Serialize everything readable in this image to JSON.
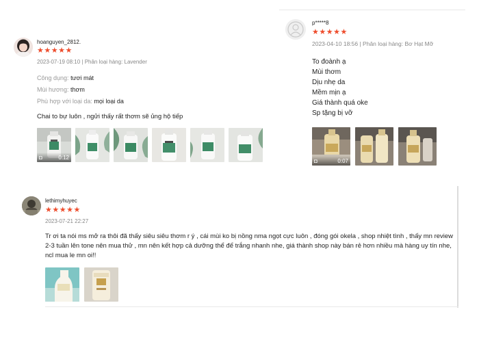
{
  "colors": {
    "star": "#ee4d2d",
    "meta": "#888888",
    "label": "#999999"
  },
  "reviews": [
    {
      "username": "hoanguyen_2812.",
      "rating": 5,
      "stars": "★★★★★",
      "meta": "2023-07-19 08:10 | Phân loại hàng: Lavender",
      "attributes": [
        {
          "label": "Công dụng:",
          "value": "tươi mát"
        },
        {
          "label": "Mùi hương:",
          "value": "thơm"
        },
        {
          "label": "Phù hợp với loại da:",
          "value": "mọi loại da"
        }
      ],
      "comment": "Chai to bự luôn , ngửi thấy rất thơm sẽ ủng hộ tiếp",
      "video_duration": "0:12"
    },
    {
      "username": "p*****8",
      "rating": 5,
      "stars": "★★★★★",
      "meta": "2023-04-10 18:56 | Phân loại hàng: Bơ Hạt Mỡ",
      "lines": [
        "To đoành ạ",
        "Mùi thơm",
        "Dịu nhẹ da",
        "Mềm mịn ạ",
        "Giá thành quá oke",
        "Sp tặng bị vỡ"
      ],
      "video_duration": "0:07"
    },
    {
      "username": "lethimyhuyec",
      "rating": 5,
      "stars": "★★★★★",
      "meta": "2023-07-21 22:27",
      "comment": "Tr ơi ta nói ms mở ra thôi đã thấy siêu siêu thơm r ý , cái mùi ko bị nồng nma ngọt cực luôn , đóng gói okela , shop nhiệt tình , thấy mn review 2-3 tuần lên tone nên mua thử , mn nên kết hợp cả dưỡng thể để trắng nhanh nhe, giá thành shop này bán rẻ hơn nhiều mà hàng uy tín nhe, ncl mua le mn oi!!"
    }
  ]
}
